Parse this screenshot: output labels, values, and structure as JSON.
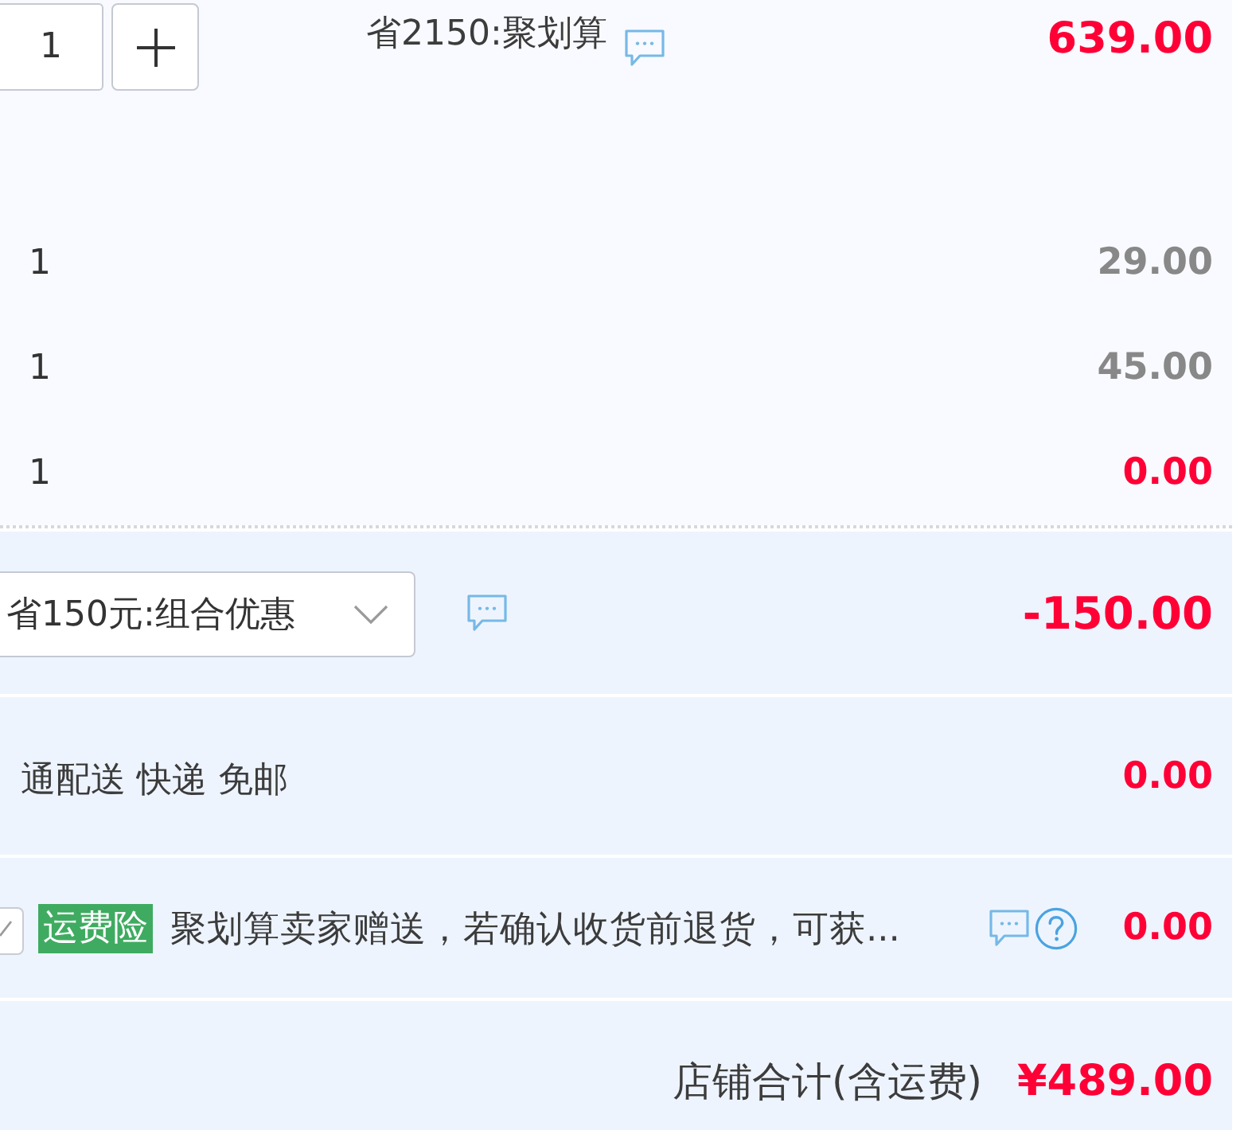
{
  "main_item": {
    "quantity": "1",
    "promotion": "省2150:聚划算",
    "price": "639.00"
  },
  "bundle_items": [
    {
      "quantity": "1",
      "price": "29.00",
      "color": "#888888"
    },
    {
      "quantity": "1",
      "price": "45.00",
      "color": "#888888"
    },
    {
      "quantity": "1",
      "price": "0.00",
      "color": "#ff0036"
    }
  ],
  "bundle_discount": {
    "selection": "省150元:组合优惠",
    "amount": "-150.00"
  },
  "delivery": {
    "method": "通配送 快递 免邮",
    "fee": "0.00"
  },
  "shipping_insurance": {
    "checked": true,
    "tag": "运费险",
    "description": "聚划算卖家赠送，若确认收货前退货，可获...",
    "fee": "0.00"
  },
  "shop_total": {
    "label": "店铺合计(含运费)",
    "amount": "¥489.00"
  }
}
